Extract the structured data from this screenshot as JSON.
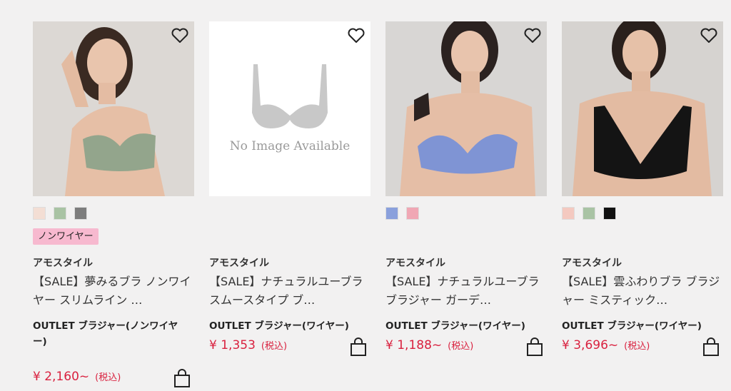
{
  "products": [
    {
      "swatches": [
        "#f3ded4",
        "#a9c3a4",
        "#7d7d7d"
      ],
      "tag": "ノンワイヤー",
      "brand": "アモスタイル",
      "name": "【SALE】夢みるブラ ノンワイヤー スリムライン …",
      "category": "OUTLET ブラジャー(ノンワイヤー)",
      "price": "¥ 2,160~",
      "tax": "(税込)"
    },
    {
      "no_image_text": "No Image Available",
      "brand": "アモスタイル",
      "name": "【SALE】ナチュラルユーブラ スムースタイプ ブ…",
      "category": "OUTLET ブラジャー(ワイヤー)",
      "price": "¥ 1,353",
      "tax": "(税込)"
    },
    {
      "swatches": [
        "#8aa0dc",
        "#f0a7b4"
      ],
      "brand": "アモスタイル",
      "name": "【SALE】ナチュラルユーブラ ブラジャー ガーデ…",
      "category": "OUTLET ブラジャー(ワイヤー)",
      "price": "¥ 1,188~",
      "tax": "(税込)"
    },
    {
      "swatches": [
        "#f4c9c0",
        "#a9c3a4",
        "#111111"
      ],
      "brand": "アモスタイル",
      "name": "【SALE】雲ふわりブラ ブラジャー ミスティック…",
      "category": "OUTLET ブラジャー(ワイヤー)",
      "price": "¥ 3,696~",
      "tax": "(税込)"
    }
  ],
  "icons": {
    "favorite": "heart-outline-icon",
    "cart": "shopping-bag-icon"
  }
}
